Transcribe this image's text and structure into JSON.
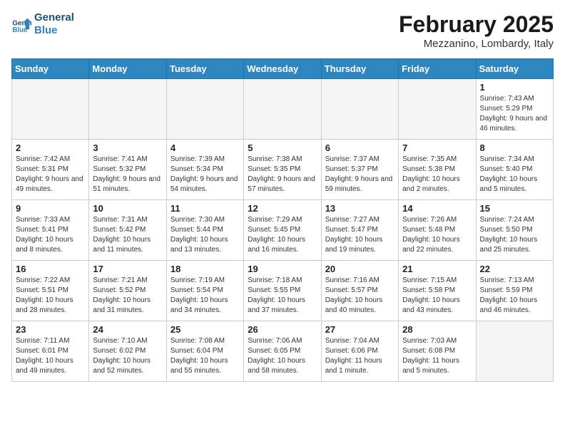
{
  "header": {
    "logo_line1": "General",
    "logo_line2": "Blue",
    "month": "February 2025",
    "location": "Mezzanino, Lombardy, Italy"
  },
  "weekdays": [
    "Sunday",
    "Monday",
    "Tuesday",
    "Wednesday",
    "Thursday",
    "Friday",
    "Saturday"
  ],
  "weeks": [
    [
      {
        "day": "",
        "info": ""
      },
      {
        "day": "",
        "info": ""
      },
      {
        "day": "",
        "info": ""
      },
      {
        "day": "",
        "info": ""
      },
      {
        "day": "",
        "info": ""
      },
      {
        "day": "",
        "info": ""
      },
      {
        "day": "1",
        "info": "Sunrise: 7:43 AM\nSunset: 5:29 PM\nDaylight: 9 hours and 46 minutes."
      }
    ],
    [
      {
        "day": "2",
        "info": "Sunrise: 7:42 AM\nSunset: 5:31 PM\nDaylight: 9 hours and 49 minutes."
      },
      {
        "day": "3",
        "info": "Sunrise: 7:41 AM\nSunset: 5:32 PM\nDaylight: 9 hours and 51 minutes."
      },
      {
        "day": "4",
        "info": "Sunrise: 7:39 AM\nSunset: 5:34 PM\nDaylight: 9 hours and 54 minutes."
      },
      {
        "day": "5",
        "info": "Sunrise: 7:38 AM\nSunset: 5:35 PM\nDaylight: 9 hours and 57 minutes."
      },
      {
        "day": "6",
        "info": "Sunrise: 7:37 AM\nSunset: 5:37 PM\nDaylight: 9 hours and 59 minutes."
      },
      {
        "day": "7",
        "info": "Sunrise: 7:35 AM\nSunset: 5:38 PM\nDaylight: 10 hours and 2 minutes."
      },
      {
        "day": "8",
        "info": "Sunrise: 7:34 AM\nSunset: 5:40 PM\nDaylight: 10 hours and 5 minutes."
      }
    ],
    [
      {
        "day": "9",
        "info": "Sunrise: 7:33 AM\nSunset: 5:41 PM\nDaylight: 10 hours and 8 minutes."
      },
      {
        "day": "10",
        "info": "Sunrise: 7:31 AM\nSunset: 5:42 PM\nDaylight: 10 hours and 11 minutes."
      },
      {
        "day": "11",
        "info": "Sunrise: 7:30 AM\nSunset: 5:44 PM\nDaylight: 10 hours and 13 minutes."
      },
      {
        "day": "12",
        "info": "Sunrise: 7:29 AM\nSunset: 5:45 PM\nDaylight: 10 hours and 16 minutes."
      },
      {
        "day": "13",
        "info": "Sunrise: 7:27 AM\nSunset: 5:47 PM\nDaylight: 10 hours and 19 minutes."
      },
      {
        "day": "14",
        "info": "Sunrise: 7:26 AM\nSunset: 5:48 PM\nDaylight: 10 hours and 22 minutes."
      },
      {
        "day": "15",
        "info": "Sunrise: 7:24 AM\nSunset: 5:50 PM\nDaylight: 10 hours and 25 minutes."
      }
    ],
    [
      {
        "day": "16",
        "info": "Sunrise: 7:22 AM\nSunset: 5:51 PM\nDaylight: 10 hours and 28 minutes."
      },
      {
        "day": "17",
        "info": "Sunrise: 7:21 AM\nSunset: 5:52 PM\nDaylight: 10 hours and 31 minutes."
      },
      {
        "day": "18",
        "info": "Sunrise: 7:19 AM\nSunset: 5:54 PM\nDaylight: 10 hours and 34 minutes."
      },
      {
        "day": "19",
        "info": "Sunrise: 7:18 AM\nSunset: 5:55 PM\nDaylight: 10 hours and 37 minutes."
      },
      {
        "day": "20",
        "info": "Sunrise: 7:16 AM\nSunset: 5:57 PM\nDaylight: 10 hours and 40 minutes."
      },
      {
        "day": "21",
        "info": "Sunrise: 7:15 AM\nSunset: 5:58 PM\nDaylight: 10 hours and 43 minutes."
      },
      {
        "day": "22",
        "info": "Sunrise: 7:13 AM\nSunset: 5:59 PM\nDaylight: 10 hours and 46 minutes."
      }
    ],
    [
      {
        "day": "23",
        "info": "Sunrise: 7:11 AM\nSunset: 6:01 PM\nDaylight: 10 hours and 49 minutes."
      },
      {
        "day": "24",
        "info": "Sunrise: 7:10 AM\nSunset: 6:02 PM\nDaylight: 10 hours and 52 minutes."
      },
      {
        "day": "25",
        "info": "Sunrise: 7:08 AM\nSunset: 6:04 PM\nDaylight: 10 hours and 55 minutes."
      },
      {
        "day": "26",
        "info": "Sunrise: 7:06 AM\nSunset: 6:05 PM\nDaylight: 10 hours and 58 minutes."
      },
      {
        "day": "27",
        "info": "Sunrise: 7:04 AM\nSunset: 6:06 PM\nDaylight: 11 hours and 1 minute."
      },
      {
        "day": "28",
        "info": "Sunrise: 7:03 AM\nSunset: 6:08 PM\nDaylight: 11 hours and 5 minutes."
      },
      {
        "day": "",
        "info": ""
      }
    ]
  ]
}
